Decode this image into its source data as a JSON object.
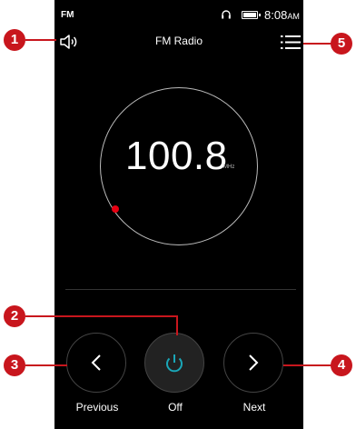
{
  "status_bar": {
    "app_label": "FM",
    "time": "8:08",
    "ampm": "AM"
  },
  "header": {
    "title": "FM Radio"
  },
  "dial": {
    "frequency": "100.8",
    "unit": "MHz"
  },
  "controls": {
    "previous_label": "Previous",
    "off_label": "Off",
    "next_label": "Next"
  },
  "callouts": [
    "1",
    "2",
    "3",
    "4",
    "5"
  ],
  "colors": {
    "accent": "#1aa6b7",
    "indicator": "#e60012",
    "callout": "#c8161d"
  }
}
